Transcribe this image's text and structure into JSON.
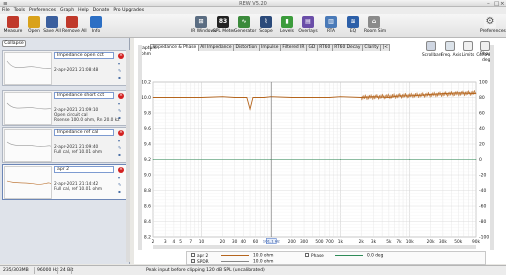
{
  "window": {
    "title": "REW V5.20"
  },
  "menu": [
    "File",
    "Tools",
    "Preferences",
    "Graph",
    "Help",
    "Donate",
    "Pro Upgrades"
  ],
  "toolbar": {
    "left": [
      {
        "label": "Measure",
        "icon": "microphone-icon",
        "color": "#c0392b"
      },
      {
        "label": "Open",
        "icon": "folder-icon",
        "color": "#d9a21b"
      },
      {
        "label": "Save All",
        "icon": "save-icon",
        "color": "#3b5f9e"
      },
      {
        "label": "Remove All",
        "icon": "trash-icon",
        "color": "#c0392b"
      },
      {
        "label": "Info",
        "icon": "info-icon",
        "color": "#2c6fc4"
      }
    ],
    "right": [
      {
        "label": "IR Windows",
        "icon": "ir-windows-icon",
        "color": "#5b6d82"
      },
      {
        "label": "SPL Meter",
        "icon": "spl-meter-icon",
        "color": "#222222",
        "text": "83"
      },
      {
        "label": "Generator",
        "icon": "generator-icon",
        "color": "#3b8a3b"
      },
      {
        "label": "Scope",
        "icon": "scope-icon",
        "color": "#2b4a7a"
      },
      {
        "label": "Levels",
        "icon": "levels-icon",
        "color": "#3c9c3c"
      },
      {
        "label": "Overlays",
        "icon": "overlays-icon",
        "color": "#6a4ea8"
      },
      {
        "label": "RTA",
        "icon": "rta-icon",
        "color": "#4a7ab8"
      },
      {
        "label": "EQ",
        "icon": "eq-icon",
        "color": "#2c5fa8"
      },
      {
        "label": "Room Sim",
        "icon": "room-sim-icon",
        "color": "#8a8a8a"
      }
    ],
    "preferences_label": "Preferences"
  },
  "left_panel": {
    "collapse_label": "Collapse",
    "measurements": [
      {
        "name": "Impedance open cct",
        "date": "2-apr-2021 21:08:48",
        "note": "",
        "note2": "",
        "selected": false
      },
      {
        "name": "Impedance short cct",
        "date": "2-apr-2021 21:09:10",
        "note": "Open circuit cal",
        "note2": "Rsense 100.0 ohm, Rn 20.0 kz",
        "selected": false
      },
      {
        "name": "Impedance ref cal",
        "date": "2-apr-2021 21:09:40",
        "note": "Full cal, ref 10.01 ohm",
        "note2": "",
        "selected": false
      },
      {
        "name": "apr 2",
        "date": "2-apr-2021 21:14:42",
        "note": "Full cal, ref 10.01 ohm",
        "note2": "",
        "selected": true
      }
    ]
  },
  "graph": {
    "units_left_top": "Capture",
    "units_left": "ohm",
    "units_right_top": "Phase",
    "units_right": "deg",
    "tabs": [
      "Impedance & Phase",
      "All Impedance",
      "Distortion",
      "Impulse",
      "Filtered IR",
      "GD",
      "RT60",
      "RT60 Decay",
      "Clarity",
      "|<"
    ],
    "active_tab": 0,
    "right_tools": [
      {
        "label": "Scrollbars",
        "icon": "scrollbars-icon"
      },
      {
        "label": "Freq. Axis",
        "icon": "freq-axis-icon"
      },
      {
        "label": "Limits",
        "icon": "limits-icon"
      },
      {
        "label": "Controls",
        "icon": "controls-icon"
      }
    ]
  },
  "chart_data": {
    "type": "line",
    "xlabel": "",
    "ylabel": "ohm",
    "y2label": "deg",
    "xscale": "log",
    "xlim": [
      2,
      90000
    ],
    "ylim": [
      8.2,
      10.2
    ],
    "y2lim": [
      -100,
      100
    ],
    "x_ticks": [
      "2",
      "3",
      "4",
      "5",
      "7",
      "10",
      "20",
      "30",
      "40",
      "60",
      "100",
      "200",
      "300",
      "500",
      "700",
      "1k",
      "2k",
      "3k",
      "5k",
      "7k",
      "10k",
      "20k",
      "30k",
      "50k",
      "90k"
    ],
    "y_ticks": [
      "10.2",
      "10.0",
      "9.8",
      "9.6",
      "9.4",
      "9.2",
      "9.0",
      "8.8",
      "8.6",
      "8.4",
      "8.2"
    ],
    "y2_ticks": [
      "100",
      "80",
      "60",
      "40",
      "20",
      "0",
      "-20",
      "-40",
      "-60",
      "-80",
      "-100"
    ],
    "grid": true,
    "cursor_x": "101.1 Hz",
    "series": [
      {
        "name": "apr 2",
        "color": "#b5651d",
        "x": [
          2,
          5,
          10,
          20,
          30,
          45,
          50,
          55,
          60,
          80,
          100,
          200,
          300,
          500,
          700,
          1000,
          2000,
          3000,
          5000,
          7000,
          10000,
          15000,
          20000,
          30000,
          50000,
          90000
        ],
        "y": [
          10.0,
          10.0,
          10.0,
          10.01,
          10.0,
          10.0,
          9.85,
          10.0,
          10.0,
          10.0,
          10.01,
          10.0,
          10.0,
          10.0,
          10.0,
          10.01,
          10.0,
          10.01,
          10.0,
          10.02,
          10.02,
          10.03,
          10.04,
          10.05,
          10.06,
          10.05
        ]
      },
      {
        "name": "Phase",
        "color": "#2e8b57",
        "x": [
          2,
          100,
          1000,
          10000,
          90000
        ],
        "y": [
          0.0,
          0.0,
          0.0,
          0.0,
          0.0
        ]
      }
    ]
  },
  "legend": [
    {
      "checked": true,
      "name": "apr 2",
      "value": "10.0 ohm",
      "color": "#b5651d"
    },
    {
      "checked": true,
      "name": "Phase",
      "value": "0.0 deg",
      "color": "#2e8b57"
    },
    {
      "checked": false,
      "name": "SPDR",
      "value": "10.0 ohm",
      "color": "#888888"
    }
  ],
  "status": {
    "memory": "235/303MB",
    "rate": "96000 Hz",
    "bits": "24 Bit",
    "message": "Peak input before clipping 120 dB SPL (uncalibrated)"
  }
}
